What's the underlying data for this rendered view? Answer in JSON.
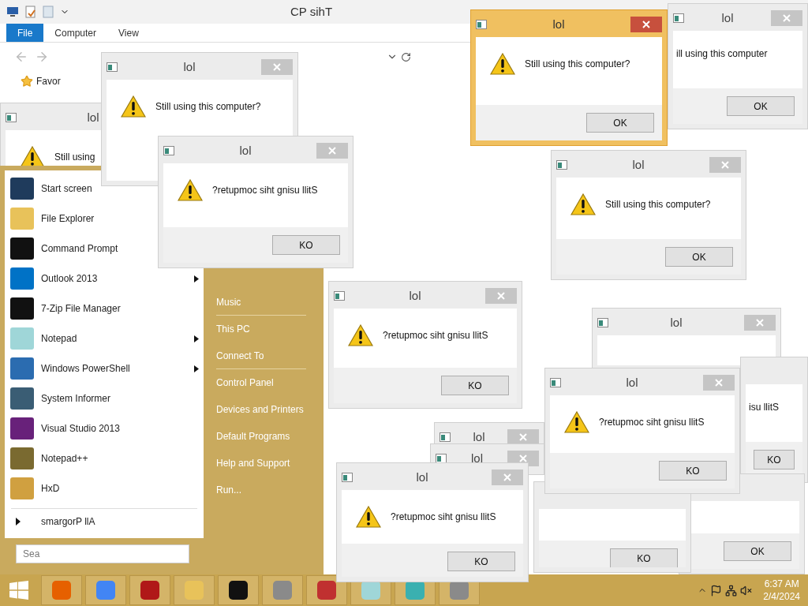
{
  "explorer": {
    "title": "CP sihT",
    "tabs": [
      {
        "label": "File",
        "selected": true
      },
      {
        "label": "Computer",
        "selected": false
      },
      {
        "label": "View",
        "selected": false
      }
    ],
    "nav_item": "Favor"
  },
  "background_windows": [
    {
      "title": "lol",
      "message": "Still using"
    },
    {
      "title": "lol",
      "message": "ill using this computer",
      "button": "OK"
    },
    {
      "title": "lol"
    },
    {
      "title": "lol"
    },
    {
      "title": "lol"
    },
    {
      "message": "isu llitS",
      "button": "KO"
    },
    {
      "button": "OK"
    },
    {
      "button": "KO"
    }
  ],
  "start_menu": {
    "programs": [
      {
        "label": "Start screen"
      },
      {
        "label": "File Explorer"
      },
      {
        "label": "Command Prompt"
      },
      {
        "label": "Outlook 2013",
        "submenu": true
      },
      {
        "label": "7-Zip File Manager",
        "submenu": false
      },
      {
        "label": "Notepad",
        "submenu": true
      },
      {
        "label": "Windows PowerShell",
        "submenu": true
      },
      {
        "label": "System Informer",
        "submenu": false
      },
      {
        "label": "Visual Studio 2013",
        "submenu": false
      },
      {
        "label": "Notepad++",
        "submenu": false
      },
      {
        "label": "HxD",
        "submenu": false
      }
    ],
    "all_programs": "smargorP llA",
    "search": {
      "placeholder": "Sea"
    },
    "places": [
      {
        "label": "Music",
        "divider_after": true
      },
      {
        "label": "This PC",
        "divider_after": false
      },
      {
        "label": "Connect To",
        "divider_after": true
      },
      {
        "label": "Control Panel",
        "divider_after": false
      },
      {
        "label": "Devices and Printers",
        "divider_after": false
      },
      {
        "label": "Default Programs",
        "divider_after": false
      },
      {
        "label": "Help and Support",
        "divider_after": false
      },
      {
        "label": "Run...",
        "divider_after": false
      }
    ]
  },
  "dialogs": [
    {
      "title": "lol",
      "message": "Still using this computer?",
      "active": false
    },
    {
      "title": "lol",
      "message": "?retupmoc siht gnisu llitS",
      "button": "KO",
      "active": false
    },
    {
      "title": "lol",
      "message": "Still using this computer?",
      "button": "OK",
      "active": true
    },
    {
      "title": "lol",
      "message": "Still using this computer?",
      "button": "OK",
      "active": false
    },
    {
      "title": "lol",
      "message": "?retupmoc siht gnisu llitS",
      "button": "KO",
      "active": false
    },
    {
      "title": "lol",
      "message": "?retupmoc siht gnisu llitS",
      "button": "KO",
      "active": false
    },
    {
      "title": "lol",
      "message": "?retupmoc siht gnisu llitS",
      "button": "KO",
      "active": false
    }
  ],
  "taskbar": {
    "time": "6:37 AM",
    "date": "2/4/2024"
  }
}
